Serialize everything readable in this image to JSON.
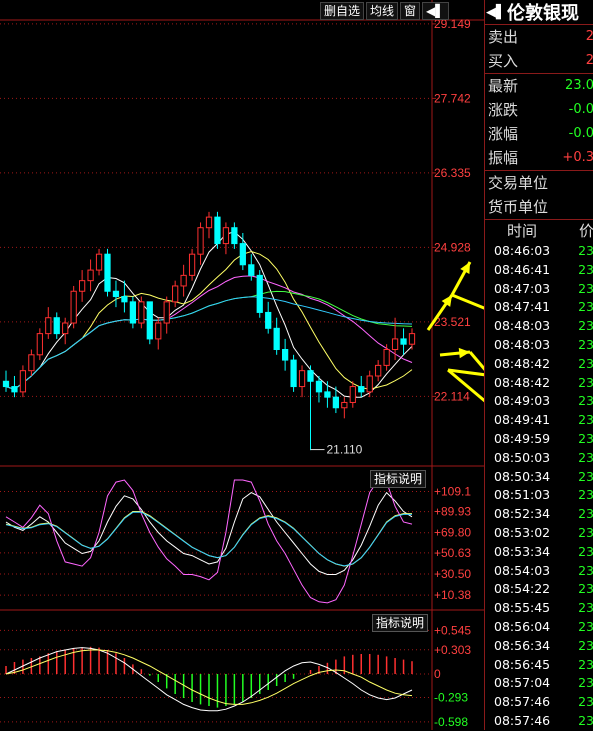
{
  "toolbar": {
    "btn1": "删自选",
    "btn2": "均线",
    "btn3": "窗",
    "btn4": "◀▌"
  },
  "main_axis": [
    "29.149",
    "27.742",
    "26.335",
    "24.928",
    "23.521",
    "22.114"
  ],
  "low_label": "21.110",
  "ind1": {
    "label": "指标说明",
    "axis": [
      "+109.1",
      "+89.93",
      "+69.80",
      "+50.63",
      "+30.50",
      "+10.38"
    ]
  },
  "ind2": {
    "label": "指标说明",
    "axis": [
      "+0.545",
      "+0.303",
      "0",
      "-0.293",
      "-0.598"
    ]
  },
  "quote": {
    "back": "◀▌",
    "name": "伦敦银现",
    "rows": [
      {
        "label": "卖出",
        "value": "2",
        "color": "#ff4040"
      },
      {
        "label": "买入",
        "value": "2",
        "color": "#ff4040"
      },
      {
        "label": "最新",
        "value": "23.0",
        "color": "#22ff22"
      },
      {
        "label": "涨跌",
        "value": "-0.0",
        "color": "#22ff22"
      },
      {
        "label": "涨幅",
        "value": "-0.0",
        "color": "#22ff22"
      },
      {
        "label": "振幅",
        "value": "+0.3",
        "color": "#ff4040"
      },
      {
        "label": "交易单位",
        "value": ""
      },
      {
        "label": "货币单位",
        "value": ""
      }
    ],
    "ticks_head": {
      "time": "时间",
      "price": "价"
    },
    "ticks": [
      {
        "t": "08:46:03",
        "v": "23"
      },
      {
        "t": "08:46:41",
        "v": "23"
      },
      {
        "t": "08:47:03",
        "v": "23"
      },
      {
        "t": "08:47:41",
        "v": "23"
      },
      {
        "t": "08:48:03",
        "v": "23"
      },
      {
        "t": "08:48:03",
        "v": "23"
      },
      {
        "t": "08:48:42",
        "v": "23"
      },
      {
        "t": "08:48:42",
        "v": "23"
      },
      {
        "t": "08:49:03",
        "v": "23"
      },
      {
        "t": "08:49:41",
        "v": "23"
      },
      {
        "t": "08:49:59",
        "v": "23"
      },
      {
        "t": "08:50:03",
        "v": "23"
      },
      {
        "t": "08:50:34",
        "v": "23"
      },
      {
        "t": "08:51:03",
        "v": "23"
      },
      {
        "t": "08:52:34",
        "v": "23"
      },
      {
        "t": "08:53:02",
        "v": "23"
      },
      {
        "t": "08:53:34",
        "v": "23"
      },
      {
        "t": "08:54:03",
        "v": "23"
      },
      {
        "t": "08:54:22",
        "v": "23"
      },
      {
        "t": "08:55:45",
        "v": "23"
      },
      {
        "t": "08:56:04",
        "v": "23"
      },
      {
        "t": "08:56:34",
        "v": "23"
      },
      {
        "t": "08:56:45",
        "v": "23"
      },
      {
        "t": "08:57:04",
        "v": "23"
      },
      {
        "t": "08:57:46",
        "v": "23"
      },
      {
        "t": "08:57:46",
        "v": "23"
      }
    ]
  },
  "chart_data": {
    "type": "candlestick",
    "ylim": [
      20.8,
      29.6
    ],
    "grid": true,
    "colors": {
      "up": "#ff3030",
      "down": "#00ffff",
      "ma5": "#ffffff",
      "ma10": "#ffff66",
      "ma20": "#ff66ff",
      "ma30": "#44ff44",
      "ma60": "#33ccff",
      "arrow": "#ffff00"
    },
    "candles": [
      [
        22.4,
        22.6,
        22.2,
        22.3
      ],
      [
        22.3,
        22.5,
        22.1,
        22.2
      ],
      [
        22.2,
        22.7,
        22.1,
        22.6
      ],
      [
        22.6,
        23.0,
        22.5,
        22.9
      ],
      [
        22.9,
        23.4,
        22.8,
        23.3
      ],
      [
        23.3,
        23.8,
        23.2,
        23.6
      ],
      [
        23.6,
        23.7,
        23.2,
        23.3
      ],
      [
        23.3,
        23.6,
        23.1,
        23.5
      ],
      [
        23.5,
        24.2,
        23.4,
        24.1
      ],
      [
        24.1,
        24.5,
        23.9,
        24.3
      ],
      [
        24.3,
        24.7,
        24.1,
        24.5
      ],
      [
        24.5,
        24.9,
        24.4,
        24.8
      ],
      [
        24.8,
        24.9,
        24.0,
        24.1
      ],
      [
        24.1,
        24.3,
        23.8,
        24.0
      ],
      [
        24.0,
        24.3,
        23.7,
        23.9
      ],
      [
        23.9,
        24.0,
        23.4,
        23.5
      ],
      [
        23.5,
        24.0,
        23.4,
        23.9
      ],
      [
        23.9,
        23.9,
        23.1,
        23.2
      ],
      [
        23.2,
        23.6,
        23.0,
        23.5
      ],
      [
        23.5,
        24.0,
        23.3,
        23.9
      ],
      [
        23.9,
        24.3,
        23.8,
        24.2
      ],
      [
        24.2,
        24.6,
        24.0,
        24.4
      ],
      [
        24.4,
        24.9,
        24.3,
        24.8
      ],
      [
        24.8,
        25.4,
        24.6,
        25.3
      ],
      [
        25.3,
        25.6,
        25.1,
        25.5
      ],
      [
        25.5,
        25.6,
        24.9,
        25.0
      ],
      [
        25.0,
        25.4,
        24.8,
        25.3
      ],
      [
        25.3,
        25.4,
        24.9,
        25.0
      ],
      [
        25.0,
        25.2,
        24.5,
        24.6
      ],
      [
        24.6,
        24.8,
        24.3,
        24.4
      ],
      [
        24.4,
        24.5,
        23.6,
        23.7
      ],
      [
        23.7,
        23.9,
        23.3,
        23.4
      ],
      [
        23.4,
        23.6,
        22.9,
        23.0
      ],
      [
        23.0,
        23.2,
        22.6,
        22.8
      ],
      [
        22.8,
        22.9,
        22.2,
        22.3
      ],
      [
        22.3,
        22.7,
        22.1,
        22.6
      ],
      [
        22.6,
        22.7,
        21.1,
        22.4
      ],
      [
        22.4,
        22.5,
        22.0,
        22.2
      ],
      [
        22.2,
        22.4,
        21.9,
        22.1
      ],
      [
        22.1,
        22.3,
        21.8,
        21.9
      ],
      [
        21.9,
        22.1,
        21.7,
        22.0
      ],
      [
        22.0,
        22.4,
        21.9,
        22.3
      ],
      [
        22.3,
        22.5,
        22.1,
        22.2
      ],
      [
        22.2,
        22.6,
        22.1,
        22.5
      ],
      [
        22.5,
        22.8,
        22.4,
        22.7
      ],
      [
        22.7,
        23.1,
        22.6,
        23.0
      ],
      [
        23.0,
        23.6,
        22.8,
        23.2
      ],
      [
        23.2,
        23.4,
        22.9,
        23.1
      ],
      [
        23.1,
        23.4,
        23.0,
        23.3
      ]
    ],
    "low_point": 21.11,
    "ind1": {
      "ylim": [
        0,
        120
      ],
      "k": [
        80,
        75,
        72,
        78,
        85,
        80,
        70,
        60,
        55,
        50,
        52,
        62,
        80,
        95,
        105,
        102,
        92,
        80,
        70,
        62,
        56,
        50,
        48,
        44,
        40,
        42,
        55,
        80,
        102,
        108,
        104,
        92,
        80,
        70,
        60,
        50,
        40,
        33,
        30,
        30,
        34,
        44,
        58,
        76,
        96,
        108,
        100,
        90,
        85
      ],
      "d": [
        78,
        76,
        74,
        75,
        78,
        79,
        76,
        70,
        64,
        58,
        55,
        57,
        64,
        74,
        84,
        90,
        90,
        86,
        80,
        74,
        68,
        62,
        56,
        52,
        48,
        46,
        48,
        56,
        68,
        78,
        84,
        86,
        84,
        80,
        74,
        66,
        58,
        50,
        44,
        40,
        38,
        40,
        46,
        56,
        68,
        80,
        86,
        88,
        88
      ],
      "j": [
        85,
        80,
        75,
        84,
        96,
        88,
        62,
        42,
        40,
        38,
        46,
        70,
        105,
        118,
        120,
        110,
        88,
        70,
        56,
        45,
        38,
        30,
        30,
        28,
        25,
        32,
        70,
        120,
        125,
        118,
        100,
        78,
        62,
        50,
        35,
        20,
        8,
        4,
        3,
        6,
        20,
        48,
        78,
        108,
        120,
        118,
        95,
        80,
        78
      ]
    },
    "ind2": {
      "ylim": [
        -0.65,
        0.6
      ],
      "hist": [
        0.1,
        0.15,
        0.18,
        0.2,
        0.22,
        0.26,
        0.28,
        0.3,
        0.32,
        0.33,
        0.34,
        0.33,
        0.3,
        0.26,
        0.2,
        0.12,
        0.06,
        -0.02,
        -0.1,
        -0.18,
        -0.25,
        -0.3,
        -0.35,
        -0.38,
        -0.4,
        -0.42,
        -0.4,
        -0.38,
        -0.35,
        -0.3,
        -0.25,
        -0.2,
        -0.15,
        -0.1,
        -0.06,
        0.0,
        0.05,
        0.1,
        0.14,
        0.18,
        0.22,
        0.24,
        0.25,
        0.25,
        0.24,
        0.22,
        0.2,
        0.18,
        0.16
      ],
      "dif": [
        0.0,
        0.05,
        0.1,
        0.15,
        0.2,
        0.24,
        0.28,
        0.3,
        0.32,
        0.33,
        0.32,
        0.3,
        0.26,
        0.2,
        0.14,
        0.06,
        -0.02,
        -0.1,
        -0.18,
        -0.26,
        -0.32,
        -0.38,
        -0.42,
        -0.45,
        -0.46,
        -0.46,
        -0.44,
        -0.4,
        -0.35,
        -0.28,
        -0.2,
        -0.12,
        -0.04,
        0.04,
        0.1,
        0.14,
        0.15,
        0.12,
        0.08,
        0.02,
        -0.05,
        -0.12,
        -0.2,
        -0.26,
        -0.3,
        -0.32,
        -0.3,
        -0.25,
        -0.2
      ],
      "dea": [
        0.0,
        0.02,
        0.05,
        0.09,
        0.13,
        0.17,
        0.21,
        0.24,
        0.27,
        0.29,
        0.3,
        0.3,
        0.29,
        0.27,
        0.24,
        0.2,
        0.15,
        0.1,
        0.04,
        -0.02,
        -0.08,
        -0.14,
        -0.2,
        -0.25,
        -0.3,
        -0.34,
        -0.37,
        -0.38,
        -0.38,
        -0.36,
        -0.33,
        -0.29,
        -0.24,
        -0.18,
        -0.12,
        -0.07,
        -0.02,
        0.02,
        0.04,
        0.05,
        0.04,
        0.0,
        -0.04,
        -0.1,
        -0.15,
        -0.2,
        -0.24,
        -0.26,
        -0.27
      ]
    }
  }
}
